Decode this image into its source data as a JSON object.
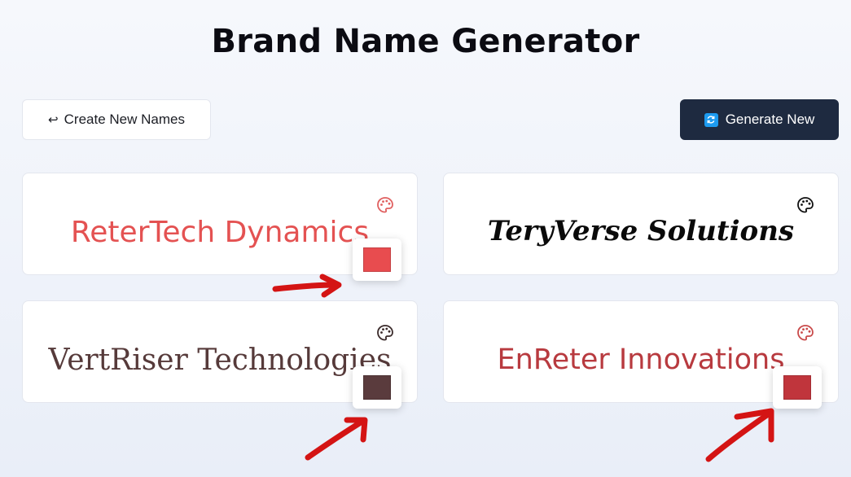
{
  "page": {
    "title": "Brand Name Generator"
  },
  "toolbar": {
    "create_label": "Create New Names",
    "create_arrow": "↩",
    "generate_label": "Generate New"
  },
  "cards": [
    {
      "name": "ReterTech Dynamics",
      "color": "#e45252",
      "swatch_color": "#e84c4f",
      "palette_color": "#e06060"
    },
    {
      "name": "TeryVerse Solutions",
      "color": "#0a0a0a",
      "swatch_color": null,
      "palette_color": "#111111"
    },
    {
      "name": "VertRiser Technologies",
      "color": "#563a3a",
      "swatch_color": "#5a3b3d",
      "palette_color": "#3a2a2a"
    },
    {
      "name": "EnReter Innovations",
      "color": "#b83a3f",
      "swatch_color": "#c0353c",
      "palette_color": "#c94a4a"
    }
  ],
  "annotations": {
    "arrow_color": "#d41414"
  },
  "icons": {
    "palette": "palette-icon",
    "refresh": "refresh-icon",
    "return_arrow": "return-arrow-icon"
  }
}
